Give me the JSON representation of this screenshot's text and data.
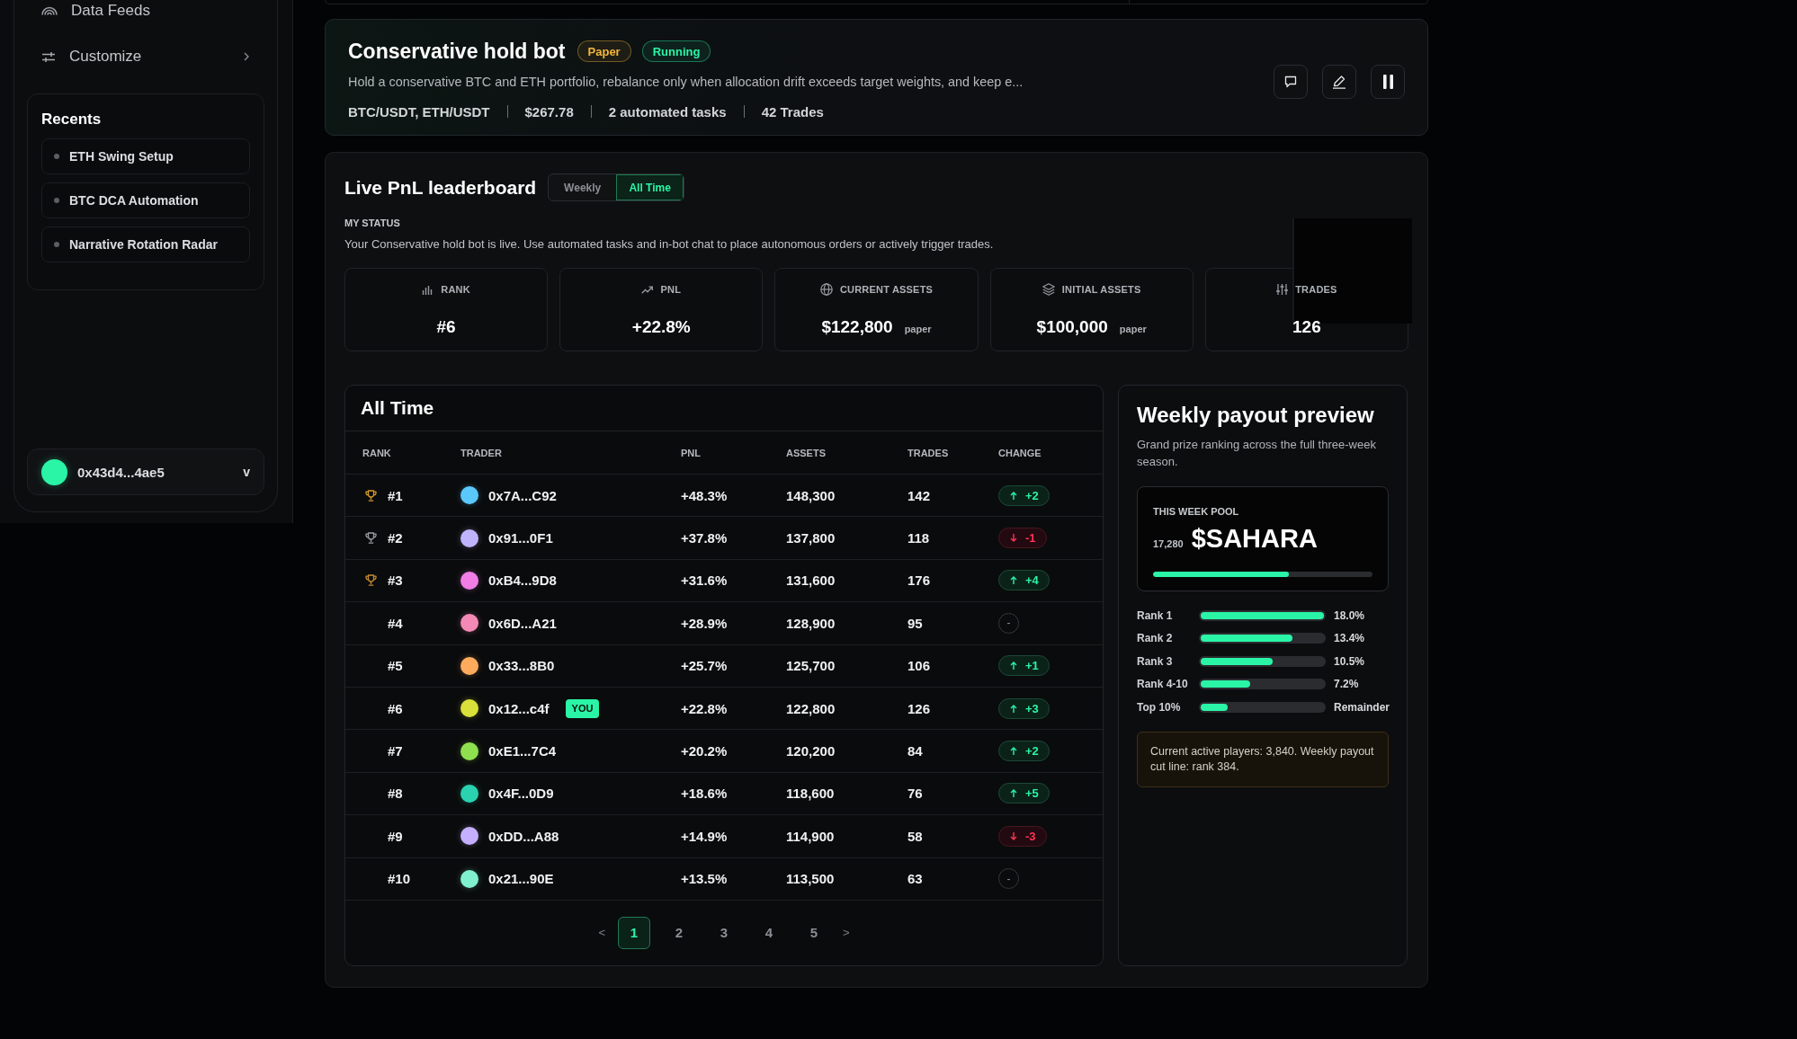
{
  "sidebar": {
    "nav": [
      {
        "label": "Data Feeds",
        "has_submenu": false
      },
      {
        "label": "Customize",
        "has_submenu": true
      }
    ],
    "recents": {
      "title": "Recents",
      "items": [
        "ETH Swing Setup",
        "BTC DCA Automation",
        "Narrative Rotation Radar"
      ]
    },
    "wallet": {
      "address": "0x43d4...4ae5",
      "toggle": "v"
    }
  },
  "bot": {
    "title": "Conservative hold bot",
    "badges": [
      {
        "text": "Paper",
        "color": "#f2b53c"
      },
      {
        "text": "Running",
        "color": "#2af5a6"
      }
    ],
    "description": "Hold a conservative BTC and ETH portfolio, rebalance only when allocation drift exceeds target weights, and keep e...",
    "meta": [
      "BTC/USDT, ETH/USDT",
      "$267.78",
      "2 automated tasks",
      "42 Trades"
    ]
  },
  "leaderboard": {
    "title": "Live PnL leaderboard",
    "tabs": [
      {
        "label": "Weekly",
        "selected": false
      },
      {
        "label": "All Time",
        "selected": true
      }
    ],
    "my_status": {
      "heading": "MY STATUS",
      "text": "Your Conservative hold bot is live. Use automated tasks and in-bot chat to place autonomous orders or actively trigger trades.",
      "stats": [
        {
          "label": "RANK",
          "value": "#6"
        },
        {
          "label": "PNL",
          "value": "+22.8%"
        },
        {
          "label": "CURRENT ASSETS",
          "value": "$122,800",
          "unit": "paper"
        },
        {
          "label": "INITIAL ASSETS",
          "value": "$100,000",
          "unit": "paper"
        },
        {
          "label": "TRADES",
          "value": "126"
        }
      ]
    },
    "table": {
      "title": "All Time",
      "columns": [
        "RANK",
        "TRADER",
        "PNL",
        "ASSETS",
        "TRADES",
        "CHANGE"
      ],
      "rows": [
        {
          "rank": "#1",
          "trophy": {
            "color": "#d49a2c"
          },
          "avatar": {
            "color": "#5ac8fa"
          },
          "trader": "0x7A...C92",
          "pnl": "+48.3%",
          "assets": "148,300",
          "trades": "142",
          "change": {
            "kind": "up",
            "text": "+2"
          }
        },
        {
          "rank": "#2",
          "trophy": {
            "color": "#9a9da2"
          },
          "avatar": {
            "color": "#c0b4ff"
          },
          "trader": "0x91...0F1",
          "pnl": "+37.8%",
          "assets": "137,800",
          "trades": "118",
          "change": {
            "kind": "down",
            "text": "-1"
          }
        },
        {
          "rank": "#3",
          "trophy": {
            "color": "#c78a2e"
          },
          "avatar": {
            "color": "#f07ee6"
          },
          "trader": "0xB4...9D8",
          "pnl": "+31.6%",
          "assets": "131,600",
          "trades": "176",
          "change": {
            "kind": "up",
            "text": "+4"
          }
        },
        {
          "rank": "#4",
          "avatar": {
            "color": "#f589b5"
          },
          "trader": "0x6D...A21",
          "pnl": "+28.9%",
          "assets": "128,900",
          "trades": "95",
          "change": {
            "kind": "flat",
            "text": "-"
          }
        },
        {
          "rank": "#5",
          "avatar": {
            "color": "#ffab5e"
          },
          "trader": "0x33...8B0",
          "pnl": "+25.7%",
          "assets": "125,700",
          "trades": "106",
          "change": {
            "kind": "up",
            "text": "+1"
          }
        },
        {
          "rank": "#6",
          "avatar": {
            "color": "#d9e03a"
          },
          "trader": "0x12...c4f",
          "tag": "YOU",
          "pnl": "+22.8%",
          "assets": "122,800",
          "trades": "126",
          "change": {
            "kind": "up",
            "text": "+3"
          }
        },
        {
          "rank": "#7",
          "avatar": {
            "color": "#8fe04f"
          },
          "trader": "0xE1...7C4",
          "pnl": "+20.2%",
          "assets": "120,200",
          "trades": "84",
          "change": {
            "kind": "up",
            "text": "+2"
          }
        },
        {
          "rank": "#8",
          "avatar": {
            "color": "#2ad2b0"
          },
          "trader": "0x4F...0D9",
          "pnl": "+18.6%",
          "assets": "118,600",
          "trades": "76",
          "change": {
            "kind": "up",
            "text": "+5"
          }
        },
        {
          "rank": "#9",
          "avatar": {
            "color": "#c4b0ff"
          },
          "trader": "0xDD...A88",
          "pnl": "+14.9%",
          "assets": "114,900",
          "trades": "58",
          "change": {
            "kind": "down",
            "text": "-3"
          }
        },
        {
          "rank": "#10",
          "avatar": {
            "color": "#80f0cf"
          },
          "trader": "0x21...90E",
          "pnl": "+13.5%",
          "assets": "113,500",
          "trades": "63",
          "change": {
            "kind": "flat",
            "text": "-"
          }
        }
      ],
      "pagination": {
        "prev": "<",
        "pages": [
          {
            "label": "1",
            "selected": true
          },
          {
            "label": "2",
            "selected": false
          },
          {
            "label": "3",
            "selected": false
          },
          {
            "label": "4",
            "selected": false
          },
          {
            "label": "5",
            "selected": false
          }
        ],
        "next": ">"
      }
    },
    "payout": {
      "title": "Weekly payout preview",
      "subtitle": "Grand prize ranking across the full three-week season.",
      "pool": {
        "label": "THIS WEEK POOL",
        "amount": "17,280",
        "token": "$SAHARA",
        "level": 0.62
      },
      "tiers": [
        {
          "label": "Rank 1",
          "level": 1.0,
          "share": "18.0%"
        },
        {
          "label": "Rank 2",
          "level": 0.744,
          "share": "13.4%"
        },
        {
          "label": "Rank 3",
          "level": 0.583,
          "share": "10.5%"
        },
        {
          "label": "Rank 4-10",
          "level": 0.4,
          "share": "7.2%"
        },
        {
          "label": "Top 10%",
          "level": 0.22,
          "share": "Remainder"
        }
      ],
      "note": "Current active players: 3,840. Weekly payout cut line: rank 384."
    }
  }
}
